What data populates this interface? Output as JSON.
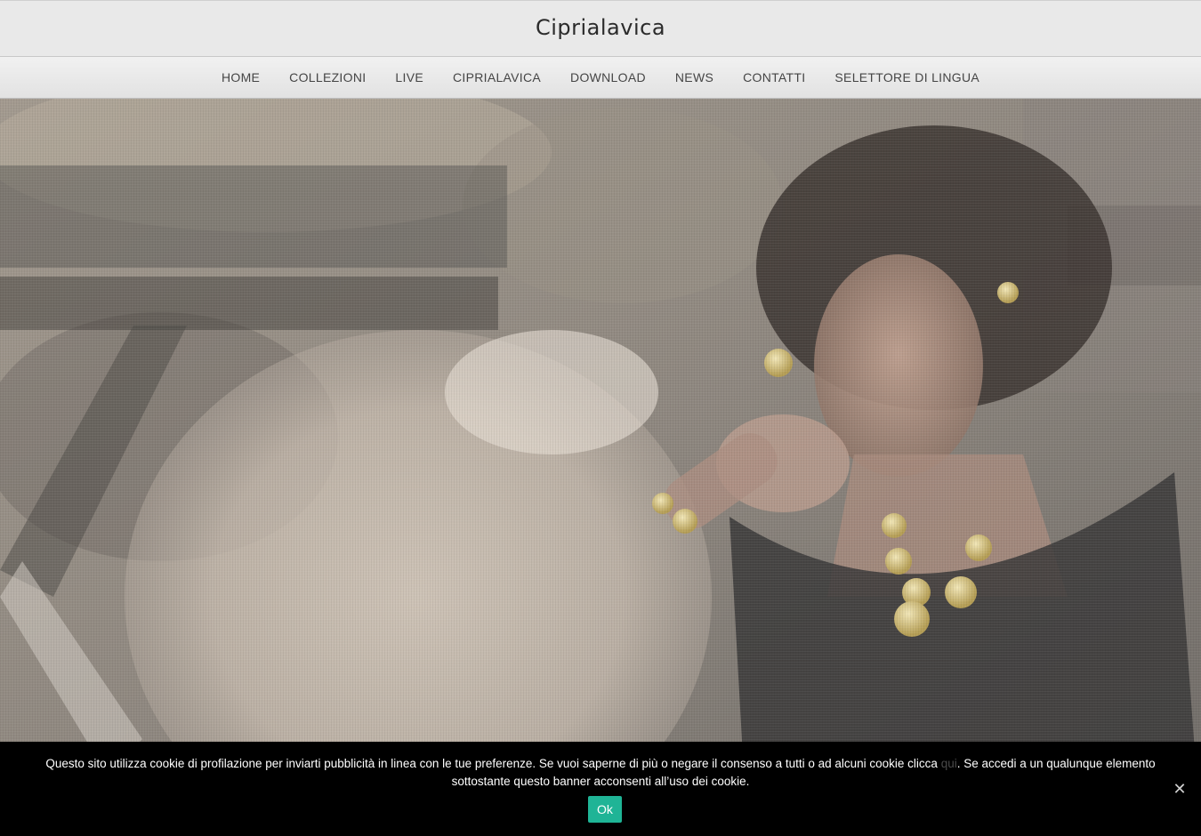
{
  "header": {
    "site_title": "Ciprialavica"
  },
  "nav": {
    "items": [
      {
        "label": "HOME"
      },
      {
        "label": "COLLEZIONI"
      },
      {
        "label": "LIVE"
      },
      {
        "label": "CIPRIALAVICA"
      },
      {
        "label": "DOWNLOAD"
      },
      {
        "label": "NEWS"
      },
      {
        "label": "CONTATTI"
      },
      {
        "label": "SELETTORE DI LINGUA"
      }
    ]
  },
  "cookie_banner": {
    "text_before_link": "Questo sito utilizza cookie di profilazione per inviarti pubblicità in linea con le tue preferenze. Se vuoi saperne di più o negare il consenso a tutti o ad alcuni cookie clicca ",
    "link_text": "qui",
    "text_after_link": ". Se accedi a un qualunque elemento sottostante questo banner acconsenti all’uso dei cookie.",
    "ok_label": "Ok",
    "close_icon": "close-icon",
    "accent_color": "#1fb496"
  }
}
